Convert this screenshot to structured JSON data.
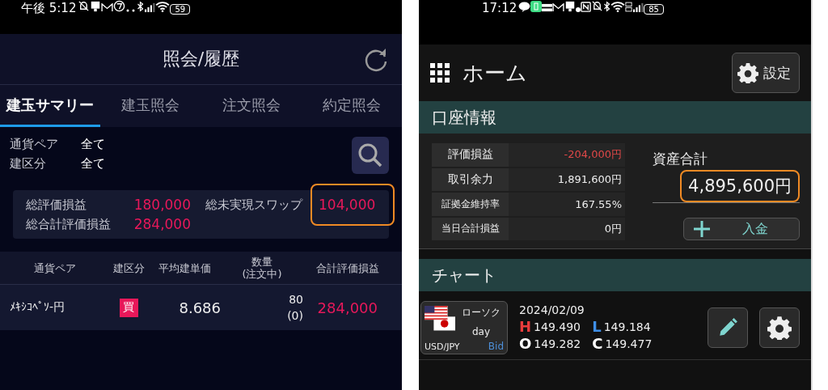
{
  "left": {
    "status_bar": {
      "time": "午後 5:12",
      "battery": "59"
    },
    "title": "照会/履歴",
    "tabs": [
      {
        "label": "建玉サマリー",
        "selected": true
      },
      {
        "label": "建玉照会",
        "selected": false
      },
      {
        "label": "注文照会",
        "selected": false
      },
      {
        "label": "約定照会",
        "selected": false
      }
    ],
    "filters": [
      {
        "label": "通貨ペア",
        "value": "全て"
      },
      {
        "label": "建区分",
        "value": "全て"
      }
    ],
    "summary": [
      {
        "label": "総評価損益",
        "value": "180,000",
        "highlighted": false
      },
      {
        "label": "総未実現スワップ",
        "value": "104,000",
        "highlighted": true
      },
      {
        "label": "総合計評価損益",
        "value": "284,000",
        "highlighted": false
      }
    ],
    "table": {
      "columns": [
        {
          "label": "通貨ペア"
        },
        {
          "label": "建区分"
        },
        {
          "label": "平均建単価"
        },
        {
          "label": "数量",
          "sublabel": "(注文中)"
        },
        {
          "label": "合計評価損益"
        }
      ],
      "rows": [
        {
          "pair": "ﾒｷｼｺﾍﾟｿ-円",
          "side": "買",
          "kind": "buy",
          "avg_price": "8.686",
          "quantity": "80",
          "pending": "(0)",
          "total_pl": "284,000"
        }
      ]
    }
  },
  "right": {
    "status_bar": {
      "time": "17:12",
      "battery": "85"
    },
    "title": "ホーム",
    "settings_button": "設定",
    "account": {
      "title": "口座情報",
      "rows": [
        {
          "label": "評価損益",
          "value": "-204,000円",
          "negative": true
        },
        {
          "label": "取引余力",
          "value": "1,891,600円",
          "negative": false
        },
        {
          "label": "証拠金維持率",
          "value": "167.55%",
          "negative": false
        },
        {
          "label": "当日合計損益",
          "value": "0円",
          "negative": false
        }
      ],
      "asset_total": {
        "label": "資産合計",
        "value": "4,895,600円",
        "highlighted": true
      },
      "deposit_button": "入金"
    },
    "chart": {
      "title": "チャート",
      "instrument": {
        "chart_type": "ローソク",
        "interval": "day",
        "pair": "USD/JPY",
        "price_type": "Bid"
      },
      "date": "2024/02/09",
      "prices": [
        {
          "key": "H",
          "value": "149.490",
          "color": "#e83c3c"
        },
        {
          "key": "L",
          "value": "149.184",
          "color": "#3f8fe8"
        },
        {
          "key": "O",
          "value": "149.282",
          "color": "#ffffff"
        },
        {
          "key": "C",
          "value": "149.477",
          "color": "#ffffff"
        }
      ]
    }
  }
}
